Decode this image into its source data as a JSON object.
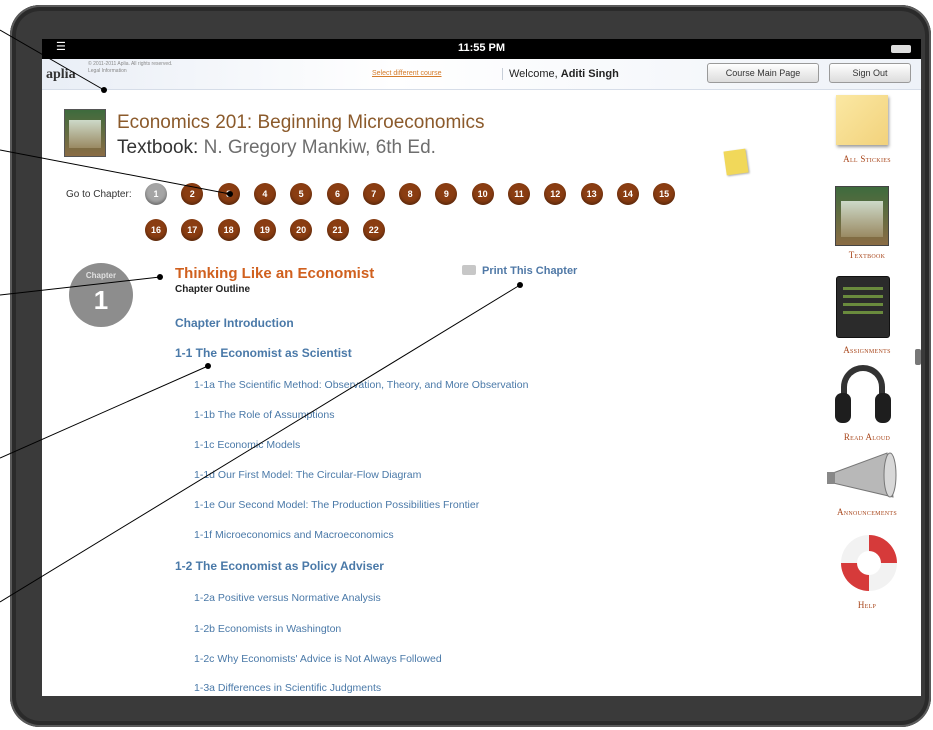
{
  "statusbar": {
    "time": "11:55 PM"
  },
  "header": {
    "logo": "aplia",
    "legal_line1": "© 2011-2011 Aplia. All rights reserved.",
    "legal_line2": "Legal Information",
    "select_course": "Select different course",
    "welcome_prefix": "Welcome, ",
    "user_name": "Aditi Singh",
    "course_main_button": "Course Main Page",
    "sign_out_button": "Sign Out"
  },
  "course": {
    "title": "Economics 201: Beginning Microeconomics",
    "textbook_label": "Textbook:",
    "textbook_value": " N. Gregory Mankiw, 6th Ed."
  },
  "chapter_nav": {
    "label": "Go to Chapter:",
    "current": "1",
    "chapters": [
      "1",
      "2",
      "3",
      "4",
      "5",
      "6",
      "7",
      "8",
      "9",
      "10",
      "11",
      "12",
      "13",
      "14",
      "15",
      "16",
      "17",
      "18",
      "19",
      "20",
      "21",
      "22"
    ]
  },
  "chapter": {
    "badge_label": "Chapter",
    "badge_number": "1",
    "title": "Thinking Like an Economist",
    "outline_label": "Chapter Outline",
    "print_link": "Print This Chapter"
  },
  "outline": {
    "intro": "Chapter Introduction",
    "sec1": "1-1 The Economist as Scientist",
    "sec1_items": [
      "1-1a The Scientific Method: Observation, Theory, and More Observation",
      "1-1b The Role of Assumptions",
      "1-1c Economic Models",
      "1-1d Our First Model: The Circular-Flow Diagram",
      "1-1e Our Second Model: The Production Possibilities Frontier",
      "1-1f Microeconomics and Macroeconomics"
    ],
    "sec2": "1-2 The Economist as Policy Adviser",
    "sec2_items": [
      "1-2a Positive versus Normative Analysis",
      "1-2b Economists in Washington",
      "1-2c Why Economists' Advice is Not Always Followed",
      "1-3a Differences in Scientific Judgments"
    ]
  },
  "rail": {
    "stickies": "All Stickies",
    "textbook": "Textbook",
    "assignments": "Assignments",
    "read_aloud": "Read Aloud",
    "announcements": "Announcements",
    "help": "Help"
  },
  "colors": {
    "chapter_chip": "#8a3d12",
    "chapter_current": "#a5a5a5",
    "link_blue": "#4a79a8",
    "chapter_title": "#d0601e",
    "rail_label": "#a8461b"
  }
}
